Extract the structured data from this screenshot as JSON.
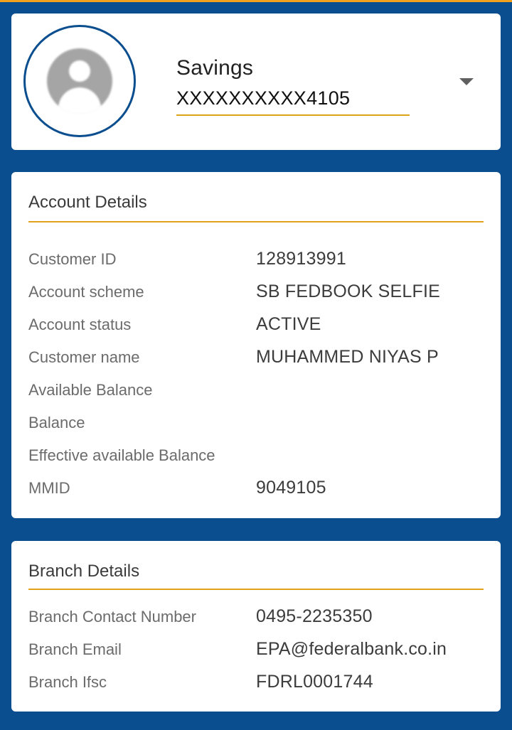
{
  "account": {
    "type": "Savings",
    "number": "XXXXXXXXXX4105"
  },
  "account_details": {
    "title": "Account Details",
    "rows": [
      {
        "label": "Customer ID",
        "value": "128913991"
      },
      {
        "label": "Account scheme",
        "value": "SB FEDBOOK SELFIE"
      },
      {
        "label": "Account status",
        "value": "ACTIVE"
      },
      {
        "label": "Customer name",
        "value": "MUHAMMED NIYAS P"
      },
      {
        "label": "Available Balance",
        "value": ""
      },
      {
        "label": "Balance",
        "value": ""
      },
      {
        "label": "Effective available Balance",
        "value": ""
      },
      {
        "label": "MMID",
        "value": "9049105"
      }
    ]
  },
  "branch_details": {
    "title": "Branch Details",
    "rows": [
      {
        "label": "Branch Contact Number",
        "value": "0495-2235350"
      },
      {
        "label": "Branch Email",
        "value": "EPA@federalbank.co.in"
      },
      {
        "label": "Branch Ifsc",
        "value": "FDRL0001744"
      }
    ]
  },
  "colors": {
    "background": "#0b4e8f",
    "accent": "#e0a21a",
    "card": "#ffffff"
  }
}
